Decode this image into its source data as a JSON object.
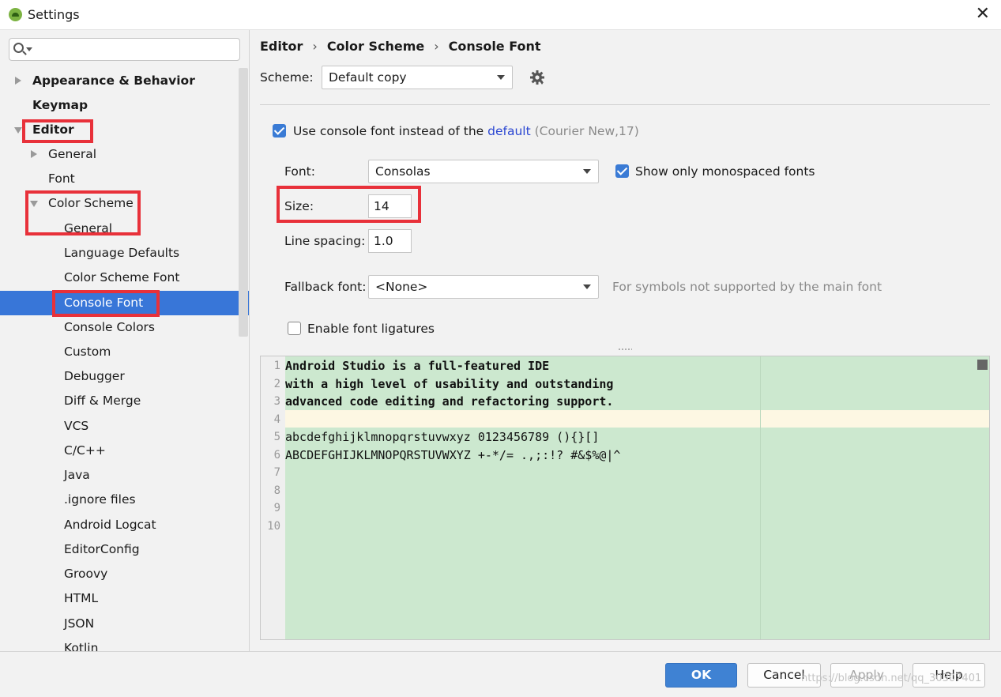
{
  "window": {
    "title": "Settings",
    "close_glyph": "✕"
  },
  "sidebar": {
    "search_placeholder": "",
    "items": [
      {
        "label": "Appearance & Behavior"
      },
      {
        "label": "Keymap"
      },
      {
        "label": "Editor"
      },
      {
        "label": "General"
      },
      {
        "label": "Font"
      },
      {
        "label": "Color Scheme"
      },
      {
        "label": "General"
      },
      {
        "label": "Language Defaults"
      },
      {
        "label": "Color Scheme Font"
      },
      {
        "label": "Console Font"
      },
      {
        "label": "Console Colors"
      },
      {
        "label": "Custom"
      },
      {
        "label": "Debugger"
      },
      {
        "label": "Diff & Merge"
      },
      {
        "label": "VCS"
      },
      {
        "label": "C/C++"
      },
      {
        "label": "Java"
      },
      {
        "label": ".ignore files"
      },
      {
        "label": "Android Logcat"
      },
      {
        "label": "EditorConfig"
      },
      {
        "label": "Groovy"
      },
      {
        "label": "HTML"
      },
      {
        "label": "JSON"
      },
      {
        "label": "Kotlin"
      }
    ]
  },
  "breadcrumb": {
    "items": [
      "Editor",
      "Color Scheme",
      "Console Font"
    ],
    "separator": "›"
  },
  "scheme": {
    "label": "Scheme:",
    "value": "Default copy"
  },
  "use_console_font": {
    "checked": true,
    "text": "Use console font instead of the",
    "link": "default",
    "hint": "(Courier New,17)"
  },
  "font": {
    "label": "Font:",
    "value": "Consolas"
  },
  "monospaced_only": {
    "checked": true,
    "label": "Show only monospaced fonts"
  },
  "size": {
    "label": "Size:",
    "value": "14"
  },
  "line_spacing": {
    "label": "Line spacing:",
    "value": "1.0"
  },
  "fallback": {
    "label": "Fallback font:",
    "value": "<None>",
    "hint": "For symbols not supported by the main font"
  },
  "ligatures": {
    "checked": false,
    "label": "Enable font ligatures"
  },
  "preview": {
    "line_numbers": [
      "1",
      "2",
      "3",
      "4",
      "5",
      "6",
      "7",
      "8",
      "9",
      "10"
    ],
    "lines": [
      "Android Studio is a full-featured IDE",
      "with a high level of usability and outstanding",
      "advanced code editing and refactoring support.",
      "",
      "abcdefghijklmnopqrstuvwxyz 0123456789 (){}[]",
      "ABCDEFGHIJKLMNOPQRSTUVWXYZ +-*/= .,;:!? #&$%@|^",
      "",
      "",
      "",
      ""
    ]
  },
  "buttons": {
    "ok": "OK",
    "cancel": "Cancel",
    "apply": "Apply",
    "help": "Help"
  },
  "watermark": "https://blog.csdn.net/qq_30307401",
  "colors": {
    "accent": "#3876d8",
    "highlight_box": "#e8313a",
    "preview_bg": "#cce8cf",
    "caret_row": "#fdf7e3"
  }
}
